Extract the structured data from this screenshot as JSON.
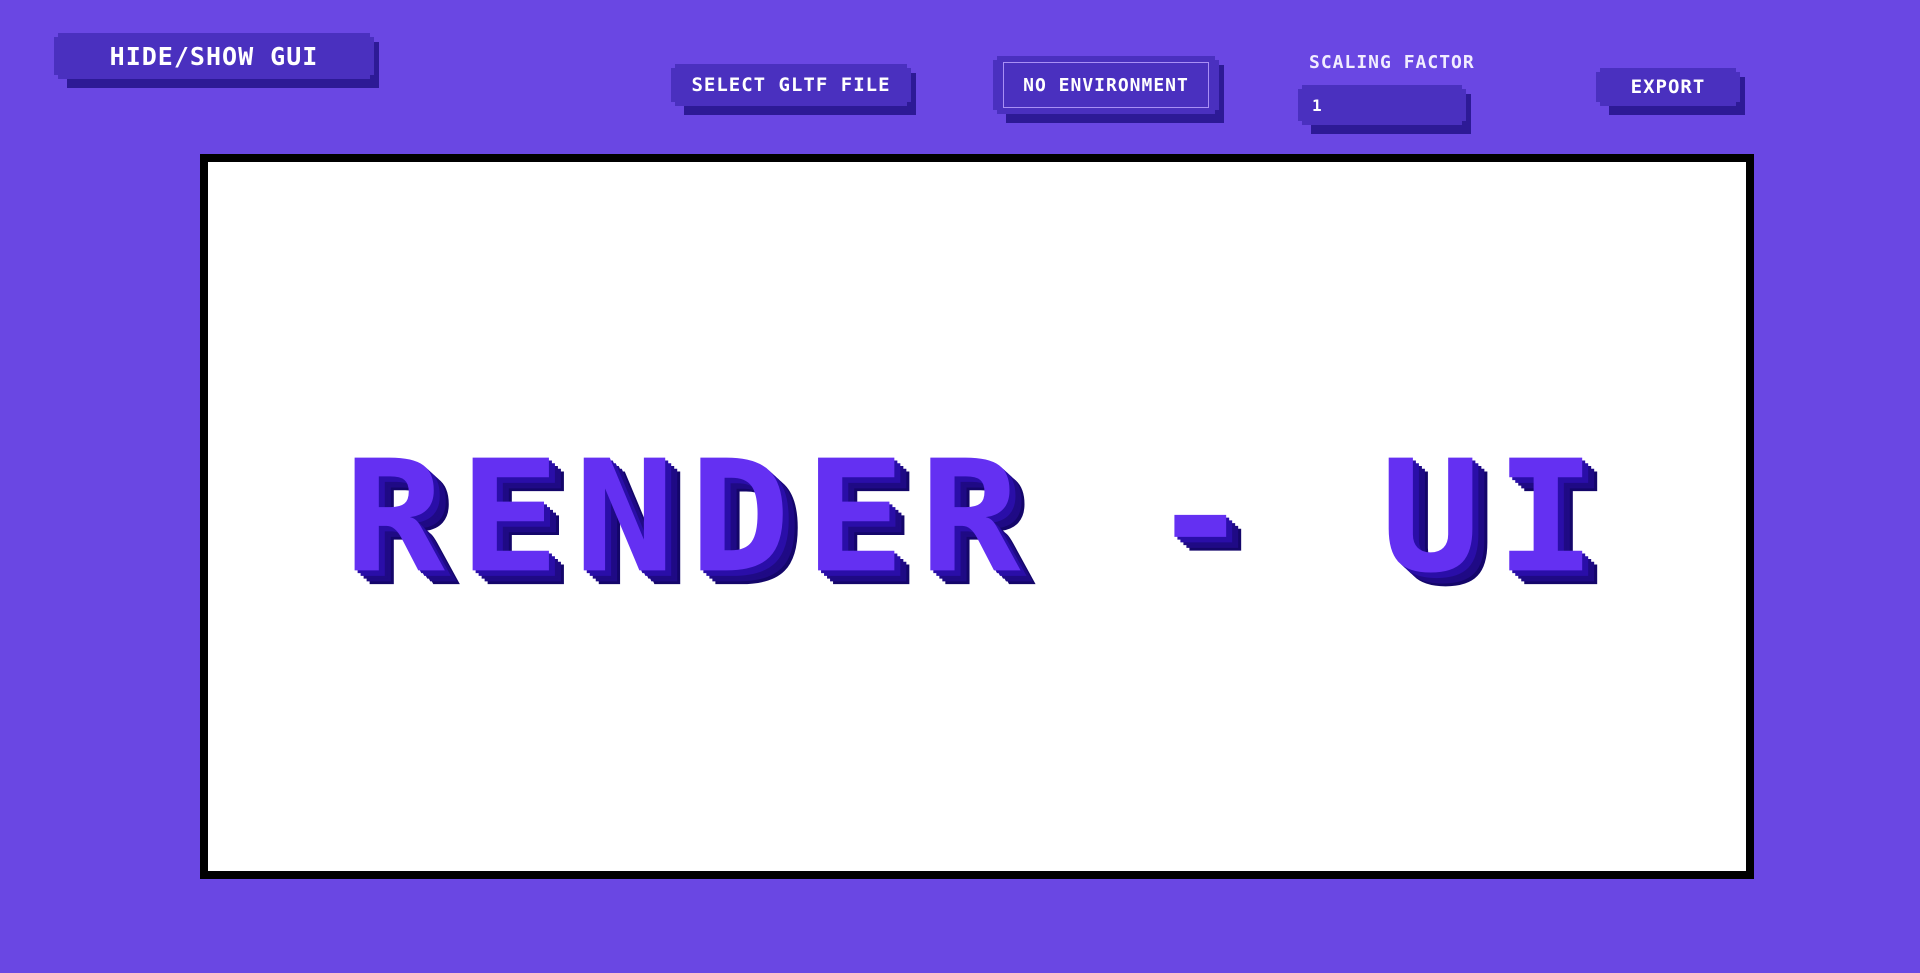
{
  "toolbar": {
    "hide_show_label": "HIDE/SHOW GUI",
    "select_gltf_label": "SELECT GLTF FILE",
    "environment_value": "NO ENVIRONMENT",
    "scaling_label": "SCALING FACTOR",
    "scaling_value": "1",
    "export_label": "EXPORT"
  },
  "viewport": {
    "title": "RENDER - UI"
  },
  "colors": {
    "background": "#6a47e3",
    "button": "#4a30bf",
    "button_shadow": "#2d1a96",
    "title": "#6430f2",
    "title_shadow": "#2a0ea8",
    "viewport_bg": "#ffffff",
    "viewport_border": "#000000"
  }
}
